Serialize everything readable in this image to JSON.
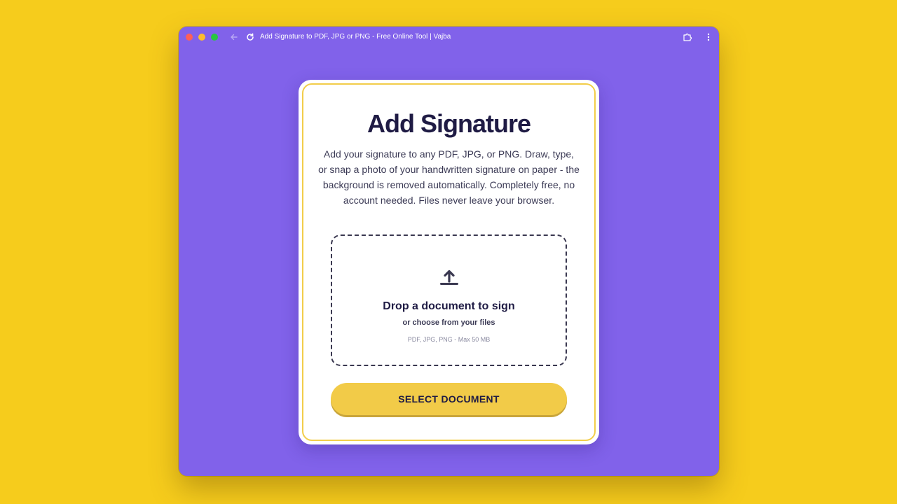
{
  "browser": {
    "tab_title": "Add Signature to PDF, JPG or PNG - Free Online Tool | Vajba"
  },
  "card": {
    "title": "Add Signature",
    "description": "Add your signature to any PDF, JPG, or PNG. Draw, type, or snap a photo of your handwritten signature on paper - the background is removed automatically. Completely free, no account needed. Files never leave your browser.",
    "dropzone": {
      "title": "Drop a document to sign",
      "subtitle": "or choose from your files",
      "formats": "PDF, JPG, PNG - Max 50 MB"
    },
    "select_button": "SELECT DOCUMENT"
  },
  "colors": {
    "background": "#f6cc1c",
    "window": "#8162ea",
    "accent": "#f2cb48",
    "text_dark": "#1f1b44"
  },
  "icons": {
    "back": "arrow-left-icon",
    "reload": "reload-icon",
    "extensions": "puzzle-icon",
    "menu": "kebab-menu-icon",
    "upload": "upload-icon"
  }
}
